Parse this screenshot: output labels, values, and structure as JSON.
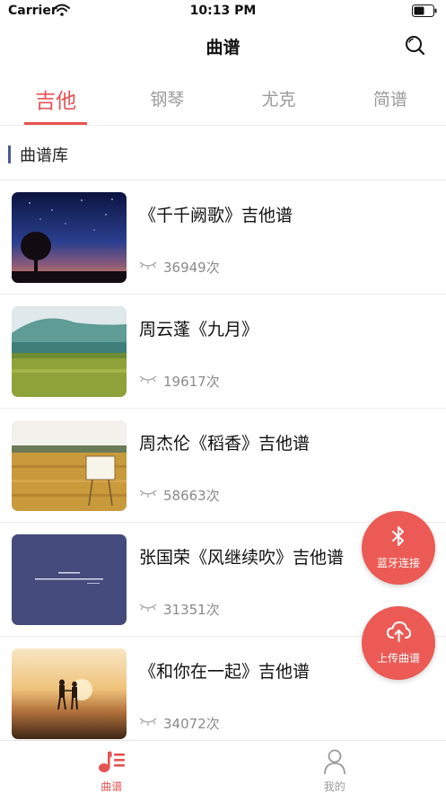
{
  "status_bar": {
    "carrier": "Carrier",
    "time": "10:13 PM"
  },
  "nav": {
    "title": "曲谱"
  },
  "tabs": [
    {
      "label": "吉他",
      "active": true
    },
    {
      "label": "钢琴",
      "active": false
    },
    {
      "label": "尤克",
      "active": false
    },
    {
      "label": "简谱",
      "active": false
    }
  ],
  "section": {
    "title": "曲谱库"
  },
  "items": [
    {
      "title": "《千千阙歌》吉他谱",
      "views": "36949次"
    },
    {
      "title": "周云蓬《九月》",
      "views": "19617次"
    },
    {
      "title": "周杰伦《稻香》吉他谱",
      "views": "58663次"
    },
    {
      "title": "张国荣《风继续吹》吉他谱",
      "views": "31351次"
    },
    {
      "title": "《和你在一起》吉他谱",
      "views": "34072次"
    }
  ],
  "fabs": {
    "bluetooth": "蓝牙连接",
    "upload": "上传曲谱"
  },
  "tab_bar": [
    {
      "label": "曲谱",
      "active": true
    },
    {
      "label": "我的",
      "active": false
    }
  ],
  "colors": {
    "accent": "#e75252",
    "fab": "#eb5a55",
    "section_bar": "#4b5a96"
  }
}
